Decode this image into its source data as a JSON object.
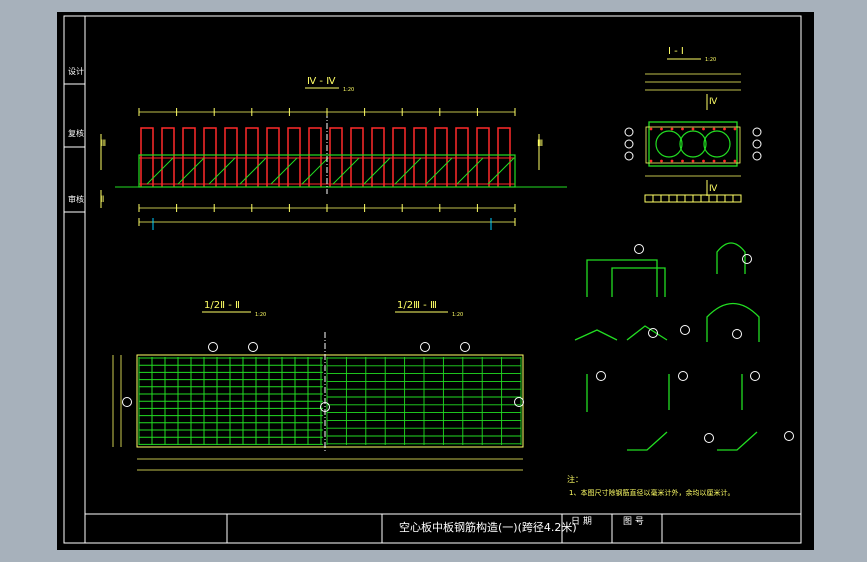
{
  "colors": {
    "background": "#a7b1bb",
    "paper": "#000000",
    "frame": "#ffffff",
    "rebar": "#ff2a2a",
    "mesh": "#22dd22",
    "dimension": "#ffff66",
    "callout": "#ffffff",
    "distribution_bar": "#00ccff"
  },
  "sheet": {
    "title": "空心板中板钢筋构造(一)(跨径4.2米)",
    "date_label": "日 期",
    "drawing_no_label": "图 号",
    "side_labels": [
      "设计",
      "复核",
      "审核"
    ]
  },
  "sections": {
    "elevation": {
      "title": "Ⅳ - Ⅳ",
      "scale": "1:20",
      "left_mark_top": "Ⅲ",
      "left_mark_bottom": "Ⅱ",
      "right_mark": "Ⅲ"
    },
    "cross_section": {
      "title": "Ⅰ - Ⅰ",
      "scale": "1:20",
      "mark": "Ⅳ"
    },
    "plan_left": {
      "title": "1/2Ⅱ - Ⅱ",
      "scale": "1:20"
    },
    "plan_right": {
      "title": "1/2Ⅲ - Ⅲ",
      "scale": "1:20"
    }
  },
  "notes": {
    "heading": "注：",
    "line1": "1、本图尺寸除钢筋直径以毫米计外，余均以厘米计。"
  }
}
